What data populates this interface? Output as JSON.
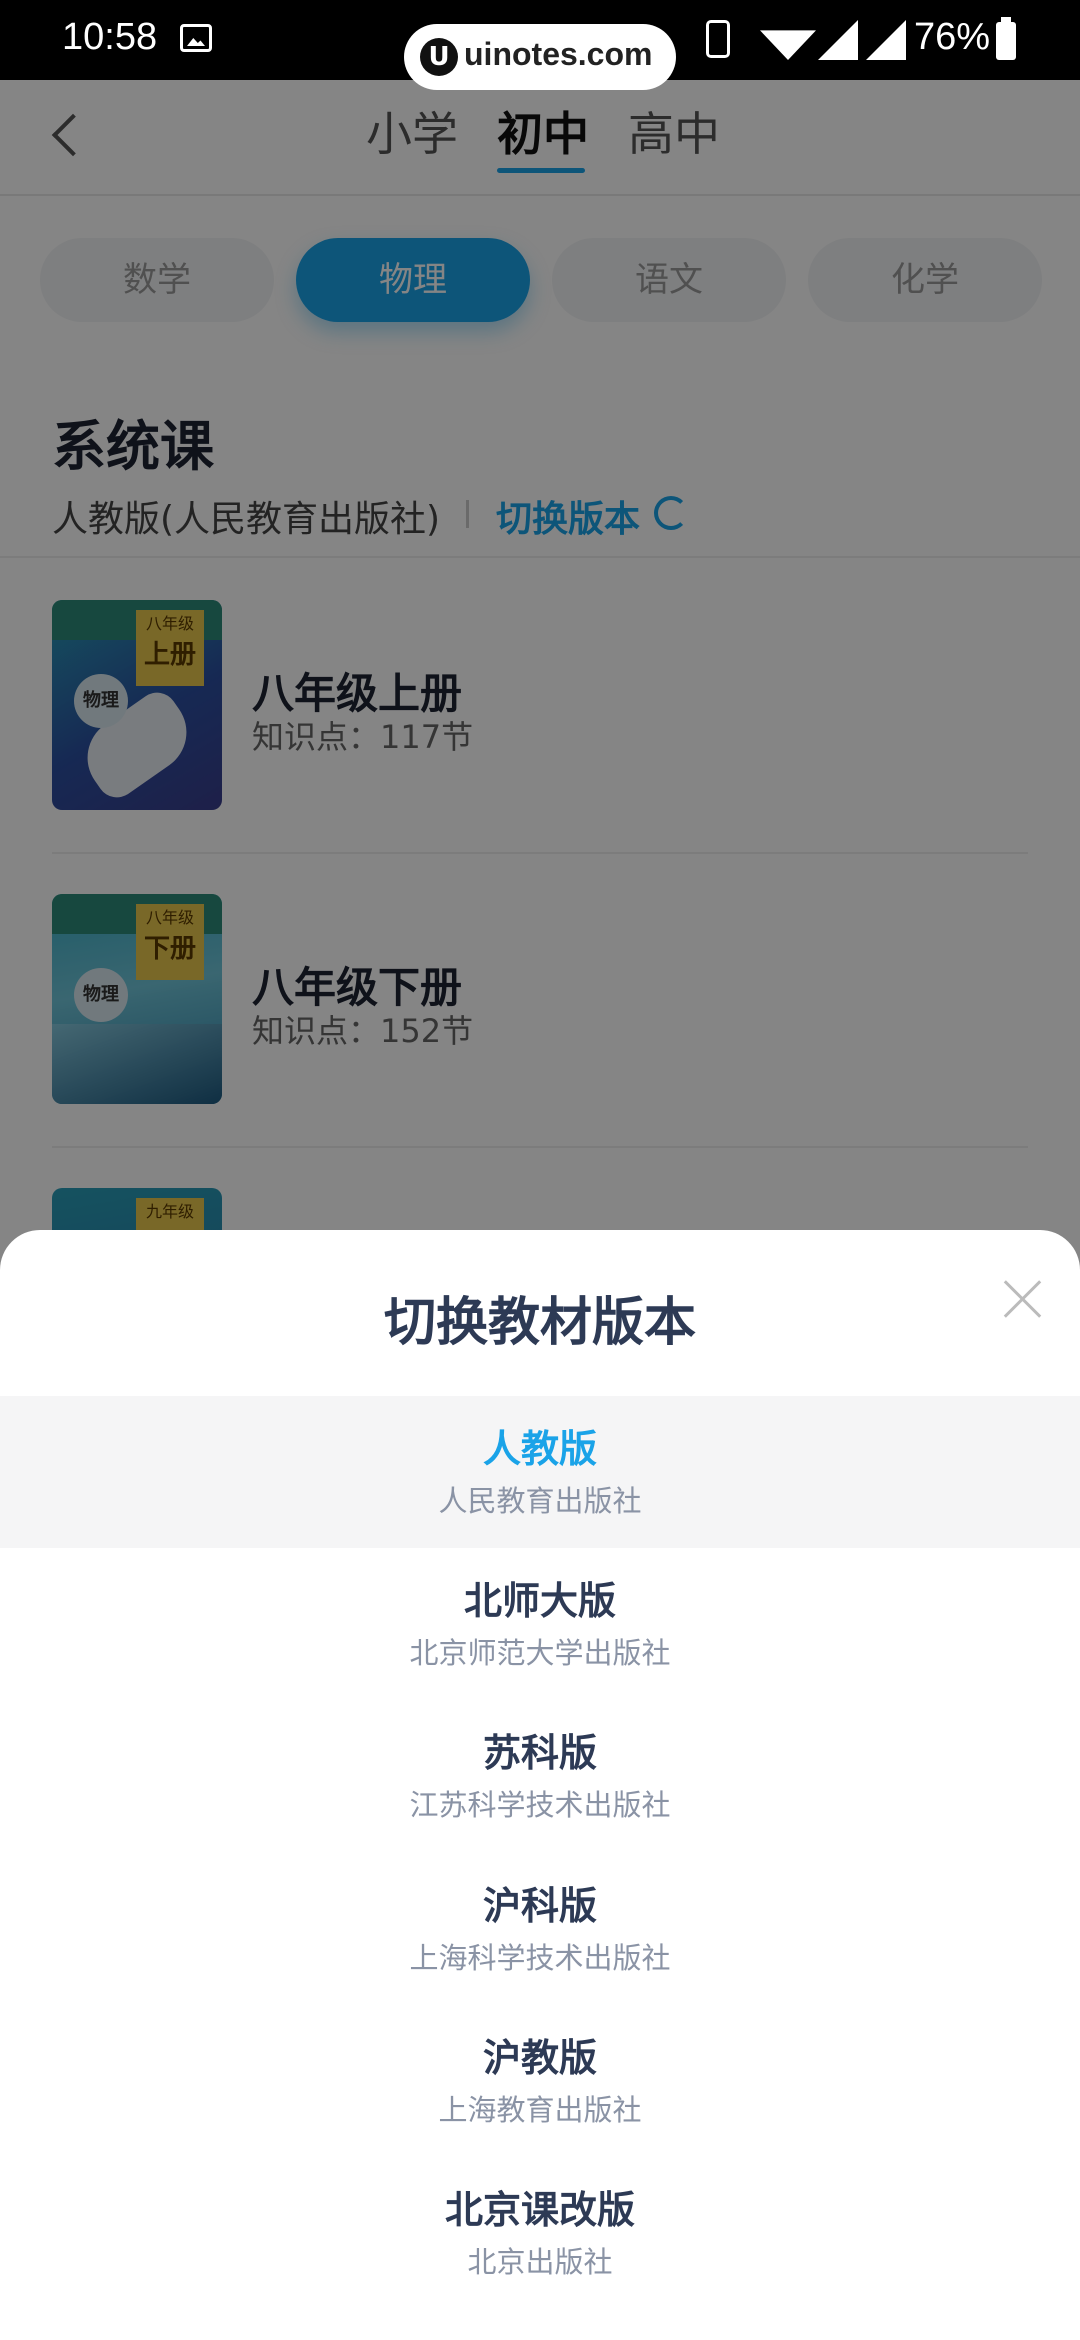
{
  "status_bar": {
    "time": "10:58",
    "battery": "76%",
    "watermark": "uinotes.com"
  },
  "header": {
    "tabs": [
      {
        "label": "小学"
      },
      {
        "label": "初中"
      },
      {
        "label": "高中"
      }
    ],
    "active_tab": "初中"
  },
  "subjects": [
    {
      "label": "数学"
    },
    {
      "label": "物理"
    },
    {
      "label": "语文"
    },
    {
      "label": "化学"
    }
  ],
  "active_subject": "物理",
  "section": {
    "title": "系统课",
    "edition": "人教版(人民教育出版社)",
    "switch_label": "切换版本"
  },
  "books": [
    {
      "cover_grade": "八年级",
      "cover_vol": "上册",
      "cover_subject": "物理",
      "title": "八年级上册",
      "points": "知识点：117节"
    },
    {
      "cover_grade": "八年级",
      "cover_vol": "下册",
      "cover_subject": "物理",
      "title": "八年级下册",
      "points": "知识点：152节"
    },
    {
      "cover_grade": "九年级"
    }
  ],
  "sheet": {
    "title": "切换教材版本",
    "options": [
      {
        "name": "人教版",
        "publisher": "人民教育出版社",
        "selected": true
      },
      {
        "name": "北师大版",
        "publisher": "北京师范大学出版社"
      },
      {
        "name": "苏科版",
        "publisher": "江苏科学技术出版社"
      },
      {
        "name": "沪科版",
        "publisher": "上海科学技术出版社"
      },
      {
        "name": "沪教版",
        "publisher": "上海教育出版社"
      },
      {
        "name": "北京课改版",
        "publisher": "北京出版社"
      }
    ]
  },
  "colors": {
    "accent": "#1aa3e8",
    "title": "#2d3a55",
    "overlay": "rgba(0,0,0,0.48)"
  }
}
